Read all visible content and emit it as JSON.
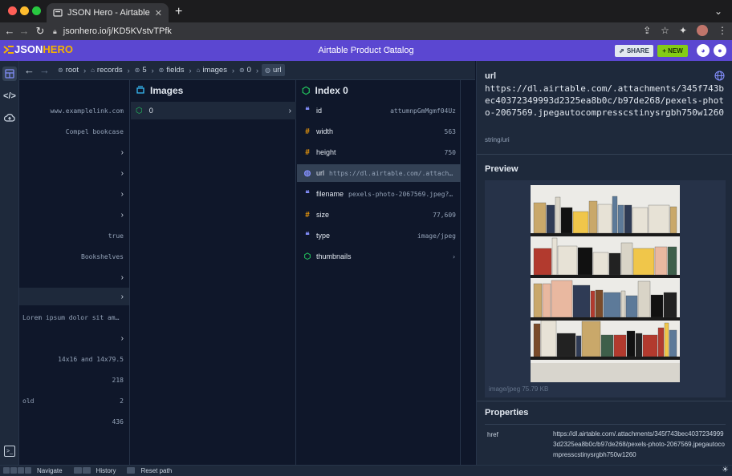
{
  "browser": {
    "tab_title": "JSON Hero - Airtable Product C",
    "tab_close": "✕",
    "new_tab": "+",
    "url": "jsonhero.io/j/KD5KVstvTPfk"
  },
  "app": {
    "logo_json": "JSON",
    "logo_hero": "HERO",
    "doc_title": "Airtable Product Catalog",
    "share_label": "SHARE",
    "new_label": "+ NEW"
  },
  "breadcrumb": [
    {
      "label": "root"
    },
    {
      "label": "records"
    },
    {
      "label": "5"
    },
    {
      "label": "fields"
    },
    {
      "label": "images"
    },
    {
      "label": "0"
    },
    {
      "label": "url"
    }
  ],
  "column1": {
    "rows": [
      {
        "value": "www.examplelink.com",
        "chevron": ""
      },
      {
        "value": "Compel bookcase",
        "chevron": ""
      },
      {
        "value": "",
        "chevron": "›"
      },
      {
        "value": "",
        "chevron": "›"
      },
      {
        "value": "",
        "chevron": "›"
      },
      {
        "value": "",
        "chevron": "›"
      },
      {
        "value": "true",
        "chevron": ""
      },
      {
        "value": "Bookshelves",
        "chevron": ""
      },
      {
        "value": "",
        "chevron": "›"
      },
      {
        "value": "",
        "chevron": "›"
      },
      {
        "value": "Lorem ipsum dolor sit am…",
        "chevron": ""
      },
      {
        "value": "",
        "chevron": "›"
      },
      {
        "value": "14x16 and 14x79.5",
        "chevron": ""
      },
      {
        "value": "218",
        "chevron": ""
      },
      {
        "value": "2",
        "chevron": "",
        "key": "old"
      },
      {
        "value": "436",
        "chevron": ""
      }
    ]
  },
  "column2": {
    "title": "Images",
    "rows": [
      {
        "key": "0",
        "chevron": "›"
      }
    ]
  },
  "column3": {
    "title": "Index 0",
    "rows": [
      {
        "type": "❝",
        "key": "id",
        "value": "attumnpGmMgmf04Uz",
        "color": "#818cf8"
      },
      {
        "type": "#",
        "key": "width",
        "value": "563",
        "color": "#f59e0b"
      },
      {
        "type": "#",
        "key": "height",
        "value": "750",
        "color": "#f59e0b"
      },
      {
        "type": "◍",
        "key": "url",
        "value": "https://dl.airtable.com/.attach…",
        "color": "#818cf8"
      },
      {
        "type": "❝",
        "key": "filename",
        "value": "pexels-photo-2067569.jpeg?…",
        "color": "#818cf8"
      },
      {
        "type": "#",
        "key": "size",
        "value": "77,609",
        "color": "#f59e0b"
      },
      {
        "type": "❝",
        "key": "type",
        "value": "image/jpeg",
        "color": "#818cf8"
      },
      {
        "type": "⬡",
        "key": "thumbnails",
        "value": "›",
        "color": "#22c55e"
      }
    ]
  },
  "panel": {
    "key": "url",
    "value": "https://dl.airtable.com/.attachments/345f743bec40372349993d2325ea8b0c/b97de268/pexels-photo-2067569.jpegautocompresscstinysrgbh750w1260",
    "type": "string/uri",
    "preview_title": "Preview",
    "image_meta": "image/jpeg  75.79 KB",
    "properties_title": "Properties",
    "prop_key": "href",
    "prop_value": "https://dl.airtable.com/.attachments/345f743bec40372349993d2325ea8b0c/b97de268/pexels-photo-2067569.jpegautocompresscstinysrgbh750w1260"
  },
  "bottom": {
    "navigate": "Navigate",
    "history": "History",
    "reset": "Reset path"
  }
}
